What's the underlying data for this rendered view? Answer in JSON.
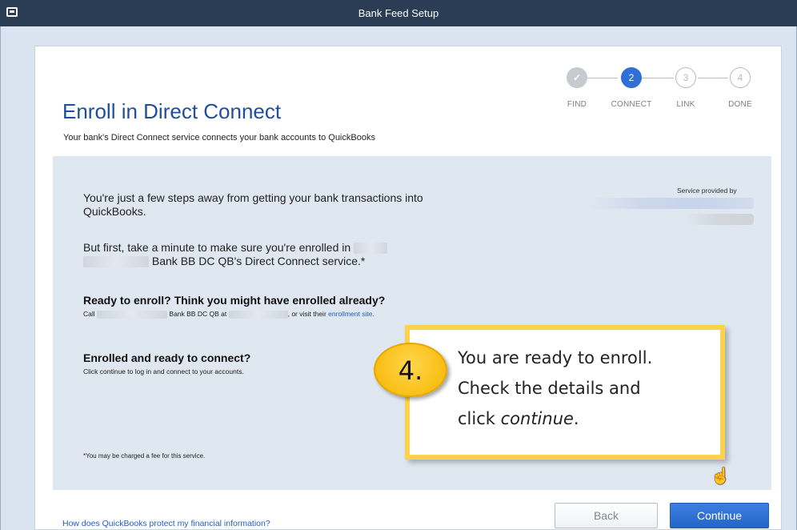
{
  "window": {
    "title": "Bank Feed Setup"
  },
  "header": {
    "title": "Enroll in Direct Connect",
    "subtitle": "Your bank's Direct Connect service connects your bank accounts to QuickBooks"
  },
  "stepper": {
    "steps": [
      {
        "number": "✓",
        "label": "FIND",
        "state": "done"
      },
      {
        "number": "2",
        "label": "CONNECT",
        "state": "active"
      },
      {
        "number": "3",
        "label": "LINK",
        "state": "upcoming"
      },
      {
        "number": "4",
        "label": "DONE",
        "state": "upcoming"
      }
    ]
  },
  "content": {
    "intro": "You're just a few steps away from getting your bank transactions into QuickBooks.",
    "enroll_check_prefix": "But first, take a minute to make sure you're enrolled in",
    "enroll_check_suffix": "Bank BB DC QB's Direct Connect service.*",
    "ready_heading": "Ready to enroll? Think you might have enrolled already?",
    "ready_call": "Call",
    "ready_bank": "Bank BB DC QB at",
    "ready_visit": ", or visit their",
    "ready_link": "enrollment site.",
    "enrolled_heading": "Enrolled and ready to connect?",
    "enrolled_sub": "Click continue to log in and connect to your accounts.",
    "footnote": "*You may be charged a fee for this service.",
    "service_provided_by": "Service provided by"
  },
  "footer": {
    "help_link": "How does QuickBooks protect my financial information?",
    "back_label": "Back",
    "continue_label": "Continue"
  },
  "callout": {
    "badge": "4.",
    "line1": "You are ready to enroll.",
    "line2": "Check the details and",
    "line3_prefix": "click ",
    "line3_em": "continue",
    "line3_suffix": "."
  },
  "colors": {
    "titlebar": "#2b3c55",
    "heading": "#1f4e9c",
    "primary_button": "#2565c9",
    "callout_border": "#ffd24d",
    "badge": "#f7b500"
  }
}
